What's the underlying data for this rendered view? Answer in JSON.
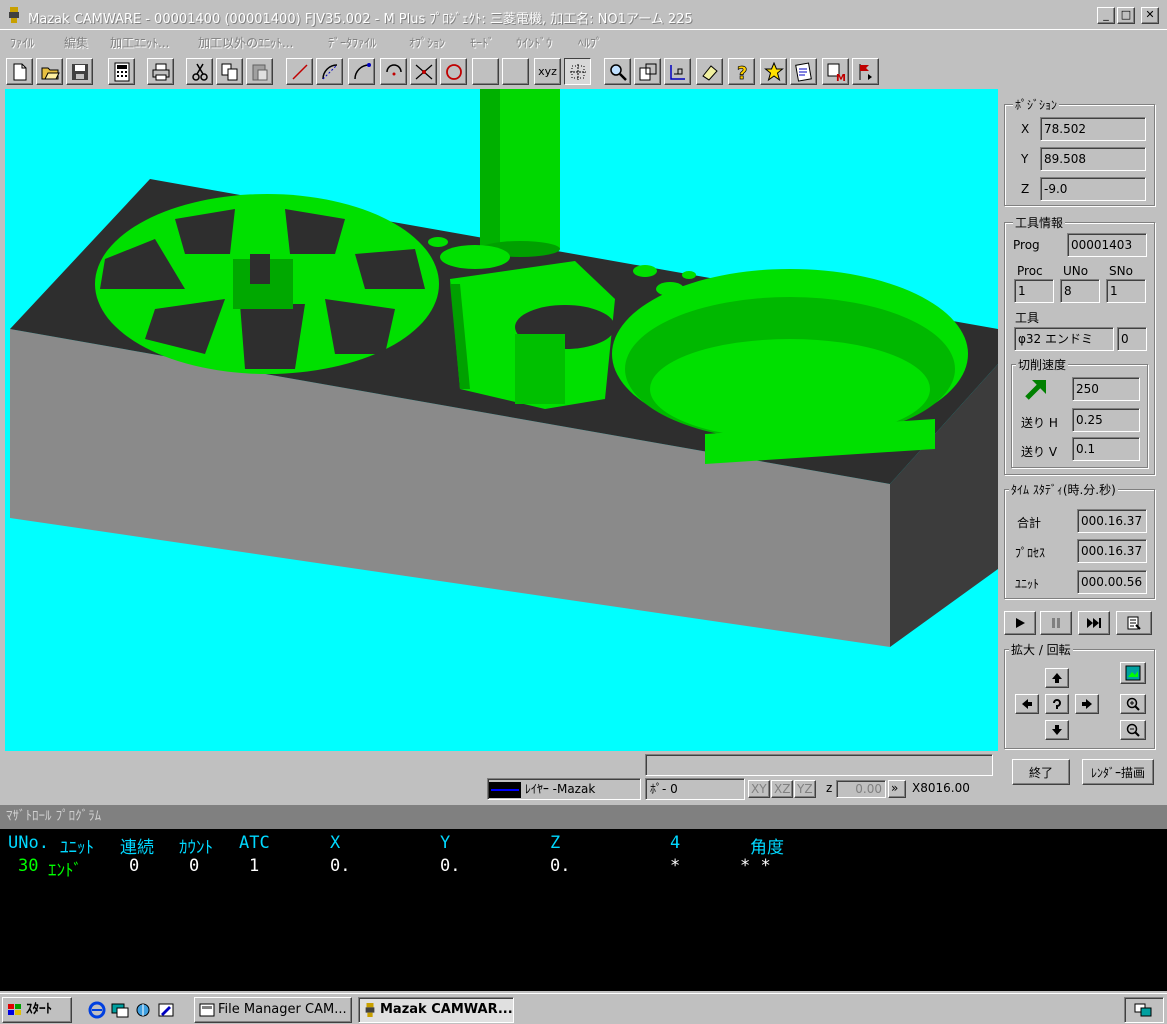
{
  "window": {
    "title": "Mazak CAMWARE - 00001400 (00001400) FJV35.002 - M Plus ﾌﾟﾛｼﾞｪｸﾄ: 三菱電機, 加工名: NO1アーム  225",
    "minimize": "_",
    "maximize": "□",
    "close": "✕"
  },
  "menu": [
    "ﾌｧｲﾙ",
    "編集",
    "加工ﾕﾆｯﾄ...",
    "加工以外のﾕﾆｯﾄ...",
    "ﾃﾞｰﾀﾌｧｲﾙ",
    "ｵﾌﾟｼｮﾝ",
    "ﾓｰﾄﾞ",
    "ｳｲﾝﾄﾞｳ",
    "ﾍﾙﾌﾟ"
  ],
  "toolbar": {
    "xyz_label": "xyz",
    "icons": [
      "new-file",
      "open-folder",
      "save",
      "calculator",
      "print",
      "cut",
      "copy",
      "paste",
      "line",
      "arc-cw",
      "arc-ccw",
      "circle-point",
      "intersect",
      "circle",
      "blank",
      "blank",
      "xyz-axes",
      "grid-select",
      "zoom",
      "window-fit",
      "profile",
      "eraser",
      "help",
      "star",
      "sheet",
      "mazak-m",
      "tool-flag"
    ]
  },
  "position": {
    "group_title": "ﾎﾟｼﾞｼｮﾝ",
    "x_label": "X",
    "x_value": "78.502",
    "y_label": "Y",
    "y_value": "89.508",
    "z_label": "Z",
    "z_value": "-9.0"
  },
  "tool_info": {
    "group_title": "工具情報",
    "prog_label": "Prog",
    "prog_value": "00001403",
    "proc_label": "Proc",
    "uno_label": "UNo",
    "sno_label": "SNo",
    "proc_value": "1",
    "uno_value": "8",
    "sno_value": "1",
    "tool_label": "工具",
    "tool_value": "φ32 エンドミ",
    "tool_num": "0",
    "cutting_title": "切削速度",
    "speed_value": "250",
    "feed_h_label": "送り H",
    "feed_h_value": "0.25",
    "feed_v_label": "送り V",
    "feed_v_value": "0.1"
  },
  "time_study": {
    "group_title": "ﾀｲﾑ ｽﾀﾃﾞｨ(時.分.秒)",
    "total_label": "合計",
    "total_value": "000.16.37",
    "process_label": "ﾌﾟﾛｾｽ",
    "process_value": "000.16.37",
    "unit_label": "ﾕﾆｯﾄ",
    "unit_value": "000.00.56"
  },
  "zoom_rotate": {
    "group_title": "拡大 / 回転"
  },
  "buttons": {
    "end": "終了",
    "render": "ﾚﾝﾀﾞｰ描画"
  },
  "status": {
    "layer": "ﾚｲﾔｰ -Mazak",
    "pointer": "ﾎﾟ- 0",
    "plane_xy": "XY",
    "plane_xz": "XZ",
    "plane_yz": "YZ",
    "z_label": "z",
    "z_value": "0.00",
    "coord": "X8016.00"
  },
  "program": {
    "title": "ﾏｻﾞﾄﾛｰﾙ ﾌﾟﾛｸﾞﾗﾑ",
    "headers": [
      "UNo.",
      "ﾕﾆｯﾄ",
      "連続",
      "ｶｳﾝﾄ",
      "ATC",
      "X",
      "Y",
      "Z",
      "4",
      "角度"
    ],
    "row": [
      "30",
      "ｴﾝﾄﾞ",
      "0",
      "0",
      "1",
      "0.",
      "0.",
      "0.",
      "*",
      "*  *"
    ]
  },
  "taskbar": {
    "start": "ｽﾀｰﾄ",
    "task1": "File Manager CAM...",
    "task2": "Mazak CAMWAR..."
  },
  "colors": {
    "viewport_bg": "#00ffff",
    "part_green": "#00e000",
    "part_gray": "#808080",
    "program_bg": "#000000",
    "program_header": "#00d8ff"
  }
}
